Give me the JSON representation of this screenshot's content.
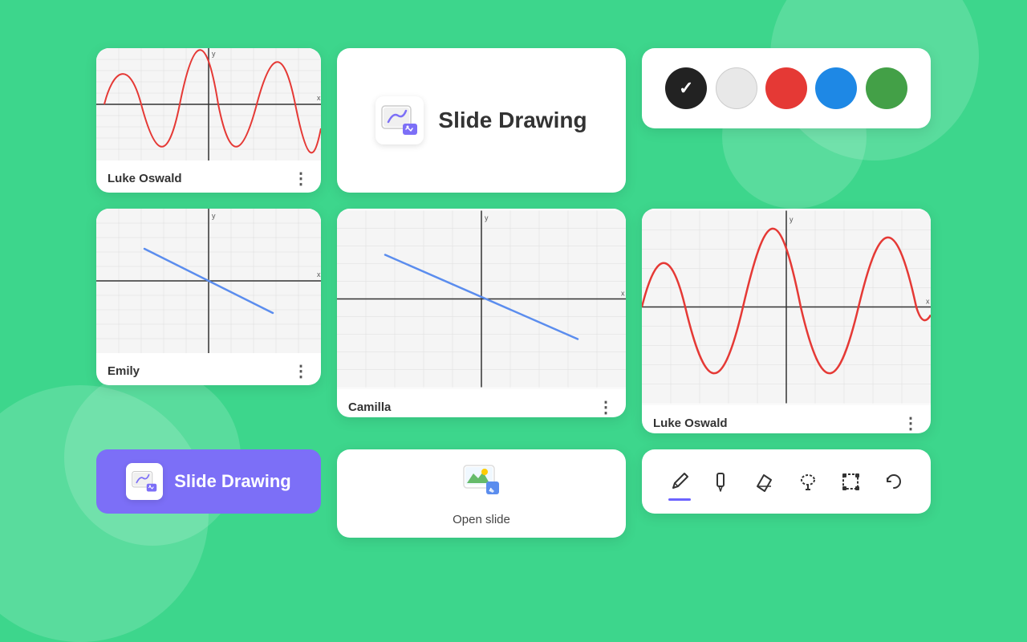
{
  "background_color": "#3dd68c",
  "cards": {
    "luke_oswald_small": {
      "name": "Luke Oswald",
      "menu_label": "⋮"
    },
    "emily": {
      "name": "Emily",
      "menu_label": "⋮"
    },
    "slide_drawing_title": {
      "label": "Slide Drawing"
    },
    "camilla": {
      "name": "Camilla",
      "menu_label": "⋮"
    },
    "luke_oswald_large": {
      "name": "Luke Oswald",
      "menu_label": "⋮"
    },
    "color_picker": {
      "colors": [
        {
          "name": "black",
          "hex": "#222222",
          "selected": true
        },
        {
          "name": "white",
          "hex": "#e8e8e8",
          "selected": false
        },
        {
          "name": "red",
          "hex": "#e53935",
          "selected": false
        },
        {
          "name": "blue",
          "hex": "#1e88e5",
          "selected": false
        },
        {
          "name": "green",
          "hex": "#43a047",
          "selected": false
        }
      ]
    },
    "open_slide": {
      "label": "Open slide"
    },
    "toolbar": {
      "tools": [
        {
          "name": "pencil",
          "active": true
        },
        {
          "name": "marker",
          "active": false
        },
        {
          "name": "eraser",
          "active": false
        },
        {
          "name": "lasso",
          "active": false
        },
        {
          "name": "transform",
          "active": false
        },
        {
          "name": "undo",
          "active": false
        }
      ]
    },
    "slide_drawing_btn": {
      "label": "Slide Drawing"
    }
  }
}
